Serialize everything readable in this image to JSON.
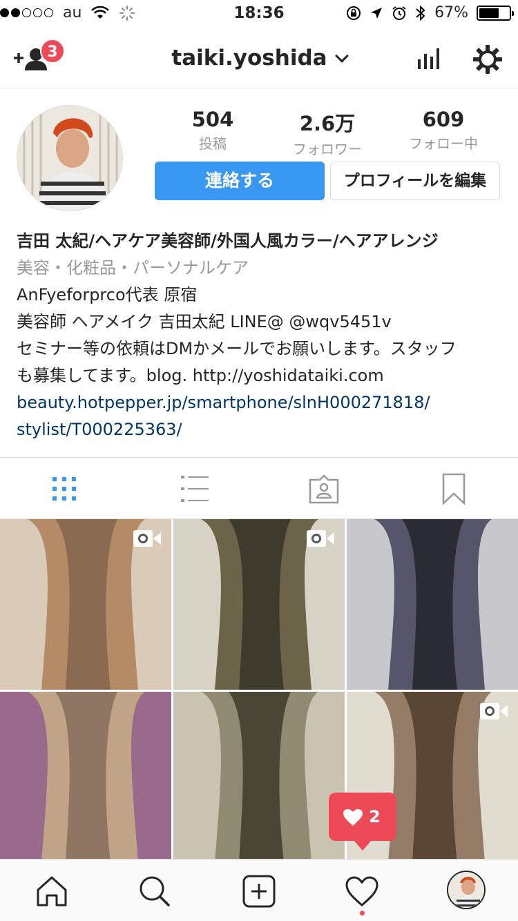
{
  "status_bar": {
    "carrier": "au",
    "time": "18:36",
    "battery": "67%",
    "battery_level": 0.67
  },
  "header": {
    "username": "taiki.yoshida",
    "add_person_badge": "3"
  },
  "profile": {
    "stats": [
      {
        "value": "504",
        "label": "投稿"
      },
      {
        "value": "2.6万",
        "label": "フォロワー"
      },
      {
        "value": "609",
        "label": "フォロー中"
      }
    ],
    "contact_button": "連絡する",
    "edit_button": "プロフィールを編集",
    "bio": {
      "name": "吉田 太紀/ヘアケア美容師/外国人風カラー/ヘアアレンジ",
      "category": "美容・化粧品・パーソナルケア",
      "line1": "AnFyeforprco代表 原宿",
      "line2": "美容師 ヘアメイク 吉田太紀 LINE@ @wqv5451v",
      "line3": "セミナー等の依頼はDMかメールでお願いします。スタッフ",
      "line4": "も募集してます。blog. http://yoshidataiki.com",
      "link1": "beauty.hotpepper.jp/smartphone/slnH000271818/",
      "link2": "stylist/T000225363/"
    }
  },
  "tabs": [
    "grid-icon",
    "list-icon",
    "tagged-icon",
    "bookmark-icon"
  ],
  "posts": [
    {
      "is_video": true,
      "colors": [
        "#8a6a50",
        "#b58a66",
        "#d9cbb8"
      ]
    },
    {
      "is_video": true,
      "colors": [
        "#3f3b2c",
        "#6c6448",
        "#d6d2c6"
      ]
    },
    {
      "is_video": false,
      "colors": [
        "#2b2b33",
        "#56566a",
        "#c8c8cc"
      ]
    },
    {
      "is_video": false,
      "colors": [
        "#8e7662",
        "#bfa488",
        "#9a6a8c"
      ]
    },
    {
      "is_video": false,
      "colors": [
        "#4a4636",
        "#8f8b72",
        "#c9c4b0"
      ]
    },
    {
      "is_video": true,
      "colors": [
        "#5a4635",
        "#957c66",
        "#e0dccf"
      ]
    }
  ],
  "like_notification": {
    "count": "2"
  },
  "colors": {
    "accent": "#3897f0",
    "badge": "#ed4956",
    "link": "#003569"
  }
}
